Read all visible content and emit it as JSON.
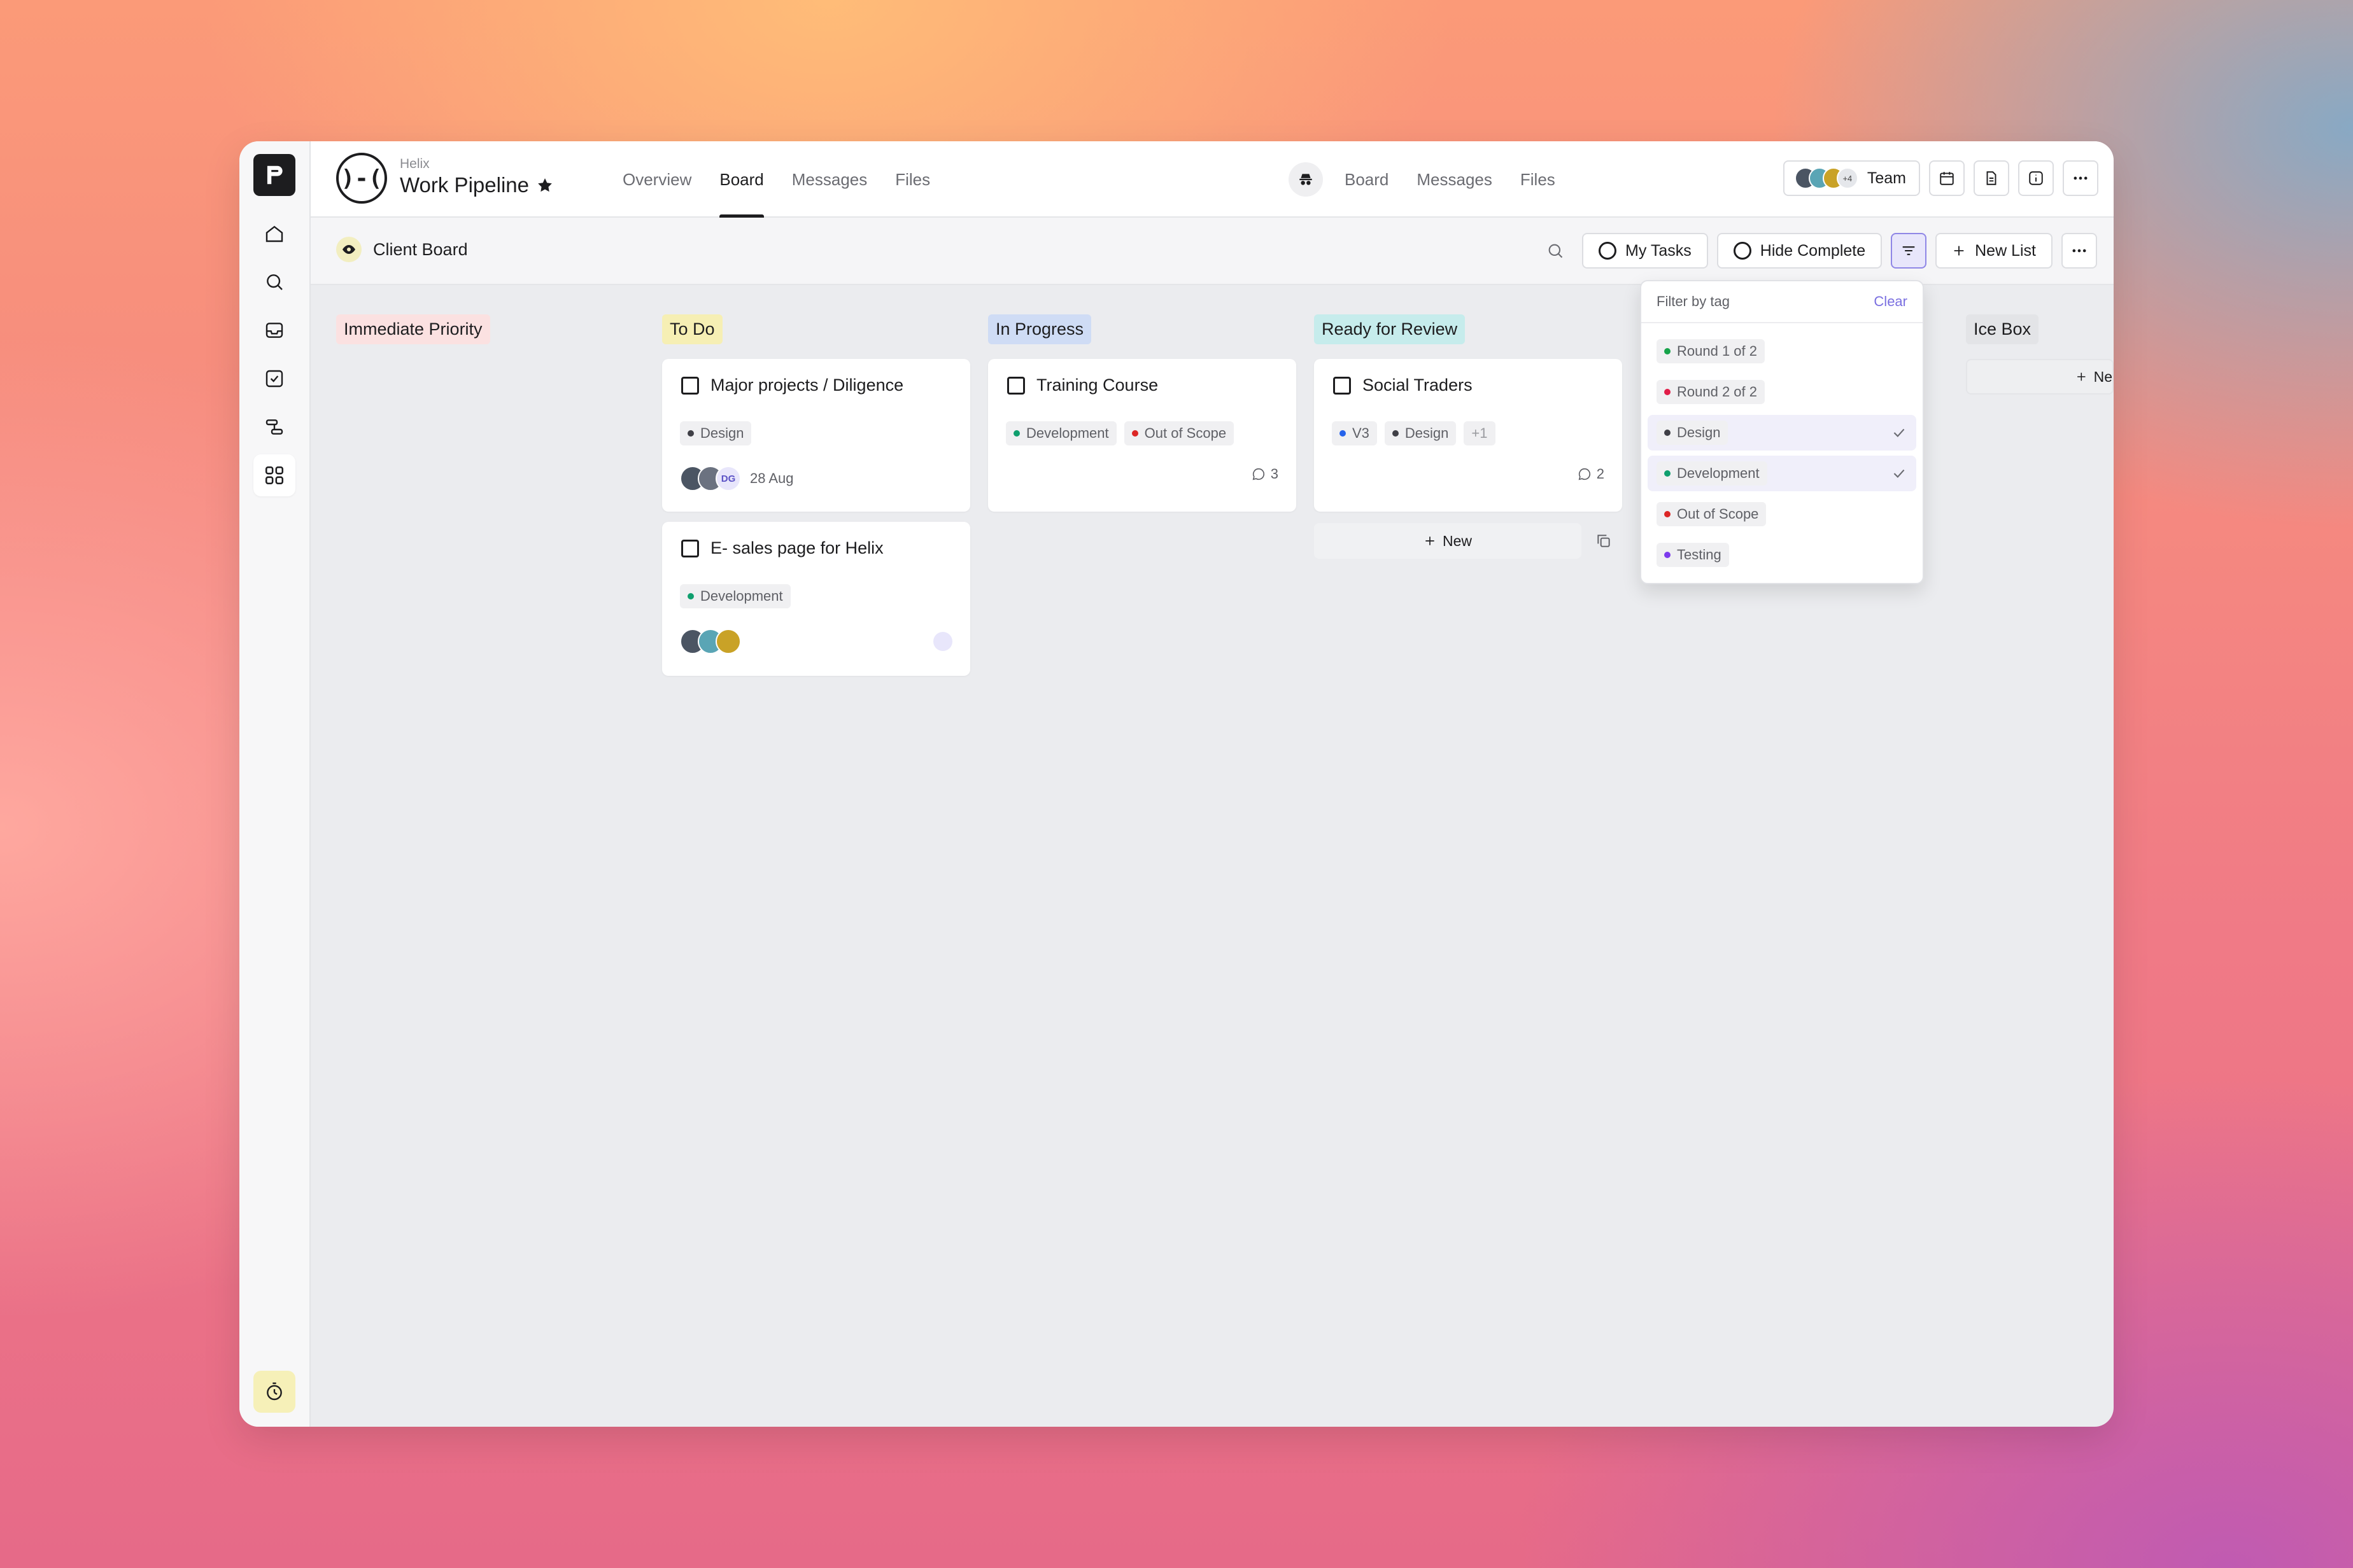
{
  "app": {
    "workspace": "Helix",
    "project_title": "Work Pipeline",
    "project_logo_text": ")-("
  },
  "nav_primary": [
    "Overview",
    "Board",
    "Messages",
    "Files"
  ],
  "nav_client": [
    "Board",
    "Messages",
    "Files"
  ],
  "header_right": {
    "team_label": "Team",
    "team_extra_count": "+4"
  },
  "subbar": {
    "board_name": "Client Board",
    "my_tasks": "My Tasks",
    "hide_complete": "Hide Complete",
    "new_list": "New List"
  },
  "columns": {
    "immediate": "Immediate Priority",
    "todo": "To Do",
    "progress": "In Progress",
    "review": "Ready for Review",
    "icebox": "Ice Box"
  },
  "column_colors": {
    "immediate": "#fbe1e1",
    "todo": "#f6efb4",
    "progress": "#cfdcf5",
    "review": "#c6ecec",
    "icebox": "#e3e4e7"
  },
  "cards": {
    "c1": {
      "title": "Major projects / Diligence",
      "tags": [
        "Design"
      ],
      "avatar_initials": "DG",
      "date": "28 Aug"
    },
    "c2": {
      "title": "E- sales page for Helix",
      "tags": [
        "Development"
      ]
    },
    "c3": {
      "title": "Training Course",
      "tags": [
        "Development",
        "Out of Scope"
      ],
      "comments": "3"
    },
    "c4": {
      "title": "Social Traders",
      "tags": [
        "V3",
        "Design",
        "+1"
      ],
      "comments": "2"
    }
  },
  "review_new_label": "New",
  "icebox_new_label": "Ne",
  "filter": {
    "title": "Filter by tag",
    "clear": "Clear",
    "options": [
      {
        "label": "Round 1 of 2",
        "color": "#16a34a",
        "selected": false
      },
      {
        "label": "Round 2 of 2",
        "color": "#e11d48",
        "selected": false
      },
      {
        "label": "Design",
        "color": "#3f3f46",
        "selected": true
      },
      {
        "label": "Development",
        "color": "#0f9f6e",
        "selected": true
      },
      {
        "label": "Out of Scope",
        "color": "#dc2626",
        "selected": false
      },
      {
        "label": "Testing",
        "color": "#7c3aed",
        "selected": false
      }
    ]
  },
  "tag_colors": {
    "Design": "#3f3f46",
    "Development": "#0f9f6e",
    "Out of Scope": "#dc2626",
    "V3": "#2563eb"
  }
}
